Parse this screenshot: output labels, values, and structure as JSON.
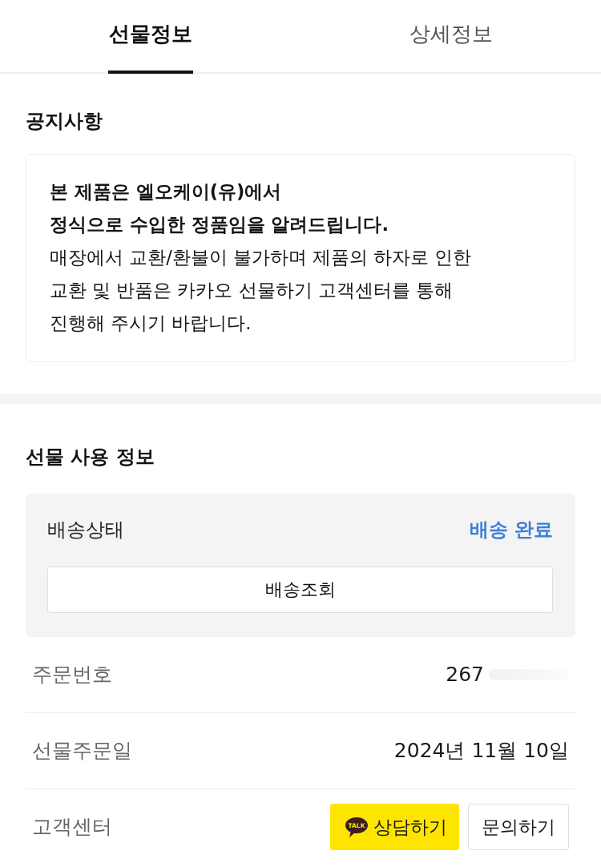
{
  "tabs": [
    {
      "label": "선물정보",
      "selected": true
    },
    {
      "label": "상세정보",
      "selected": false
    }
  ],
  "notice": {
    "title": "공지사항",
    "bold_lines": [
      "본 제품은 엘오케이(유)에서",
      "정식으로 수입한 정품임을 알려드립니다."
    ],
    "lines": [
      "매장에서 교환/환불이 불가하며 제품의 하자로 인한",
      "교환 및 반품은 카카오 선물하기 고객센터를 통해",
      "진행해 주시기 바랍니다."
    ]
  },
  "usage": {
    "title": "선물 사용 정보",
    "delivery": {
      "label": "배송상태",
      "status": "배송 완료",
      "button": "배송조회"
    },
    "rows": [
      {
        "kind": "text",
        "label": "주문번호",
        "value": "267",
        "redacted": true
      },
      {
        "kind": "text",
        "label": "선물주문일",
        "value": "2024년 11월 10일",
        "redacted": false
      },
      {
        "kind": "buttons",
        "label": "고객센터",
        "redacted": false,
        "buttons": [
          {
            "kind": "chat",
            "label": "상담하기",
            "icon_text": "TALK"
          },
          {
            "kind": "plain",
            "label": "문의하기"
          }
        ]
      }
    ]
  }
}
